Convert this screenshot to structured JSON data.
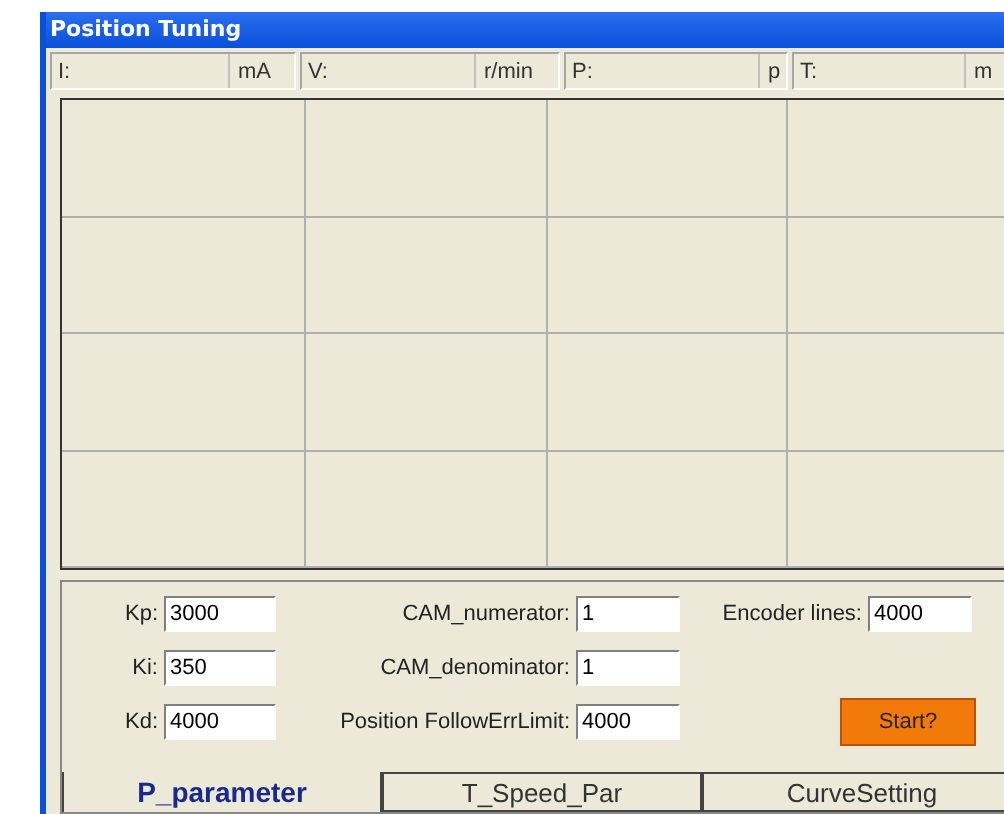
{
  "window": {
    "title": "Position Tuning"
  },
  "status_bar": [
    {
      "label": "I:",
      "unit": "mA"
    },
    {
      "label": "V:",
      "unit": "r/min"
    },
    {
      "label": "P:",
      "unit": "p"
    },
    {
      "label": "T:",
      "unit": "m"
    }
  ],
  "fields": [
    {
      "label": "Kp:",
      "value": "3000"
    },
    {
      "label": "CAM_numerator:",
      "value": "1"
    },
    {
      "label": "Encoder lines:",
      "value": "4000"
    },
    {
      "label": "Ki:",
      "value": "350"
    },
    {
      "label": "CAM_denominator:",
      "value": "1"
    },
    {
      "label": "Kd:",
      "value": "4000"
    },
    {
      "label": "Position FollowErrLimit:",
      "value": "4000"
    }
  ],
  "start_button": "Start?",
  "tabs": [
    {
      "label": "P_parameter",
      "selected": true
    },
    {
      "label": "T_Speed_Par",
      "selected": false
    },
    {
      "label": "CurveSetting",
      "selected": false
    }
  ]
}
